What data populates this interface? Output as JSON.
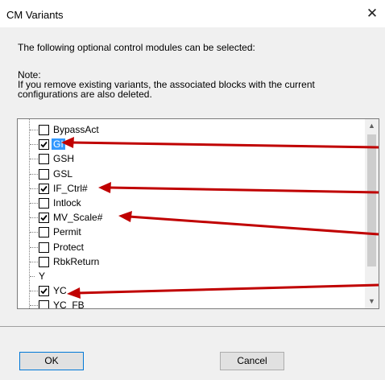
{
  "window": {
    "title": "CM Variants",
    "close_symbol": "✕"
  },
  "intro_text": "The following optional control modules can be selected:",
  "note": {
    "heading": "Note:",
    "line1": "If you remove existing variants, the associated blocks with the current",
    "line2": "configurations are also deleted."
  },
  "tree": {
    "items": [
      {
        "label": "BypassAct",
        "checked": false,
        "has_checkbox": true
      },
      {
        "label": "GI",
        "checked": true,
        "has_checkbox": true,
        "selected": true
      },
      {
        "label": "GSH",
        "checked": false,
        "has_checkbox": true
      },
      {
        "label": "GSL",
        "checked": false,
        "has_checkbox": true
      },
      {
        "label": "IF_Ctrl#",
        "checked": true,
        "has_checkbox": true
      },
      {
        "label": "Intlock",
        "checked": false,
        "has_checkbox": true
      },
      {
        "label": "MV_Scale#",
        "checked": true,
        "has_checkbox": true
      },
      {
        "label": "Permit",
        "checked": false,
        "has_checkbox": true
      },
      {
        "label": "Protect",
        "checked": false,
        "has_checkbox": true
      },
      {
        "label": "RbkReturn",
        "checked": false,
        "has_checkbox": true
      },
      {
        "label": "Y",
        "checked": false,
        "has_checkbox": false
      },
      {
        "label": "YC",
        "checked": true,
        "has_checkbox": true
      },
      {
        "label": "YC_FB",
        "checked": false,
        "has_checkbox": true
      }
    ]
  },
  "scrollbar": {
    "up_symbol": "▲",
    "down_symbol": "▼"
  },
  "buttons": {
    "ok": "OK",
    "cancel": "Cancel"
  },
  "colors": {
    "arrow": "#c00000",
    "selection": "#3399ff"
  }
}
